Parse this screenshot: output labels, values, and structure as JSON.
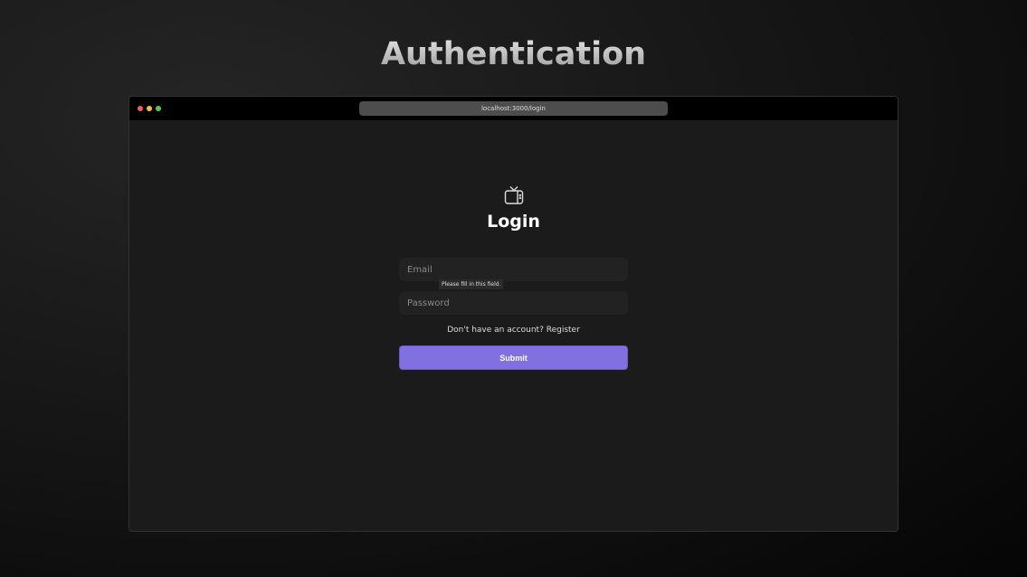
{
  "page_title": "Authentication",
  "browser": {
    "url": "localhost:3000/login",
    "dots": [
      "#ed5f57",
      "#f4bd4f",
      "#5fc553"
    ]
  },
  "form": {
    "heading": "Login",
    "email_placeholder": "Email",
    "password_placeholder": "Password",
    "tooltip": "Please fill in this field.",
    "register_prompt": "Don't have an account? Register",
    "submit": "Submit",
    "accent": "#8170e0"
  }
}
